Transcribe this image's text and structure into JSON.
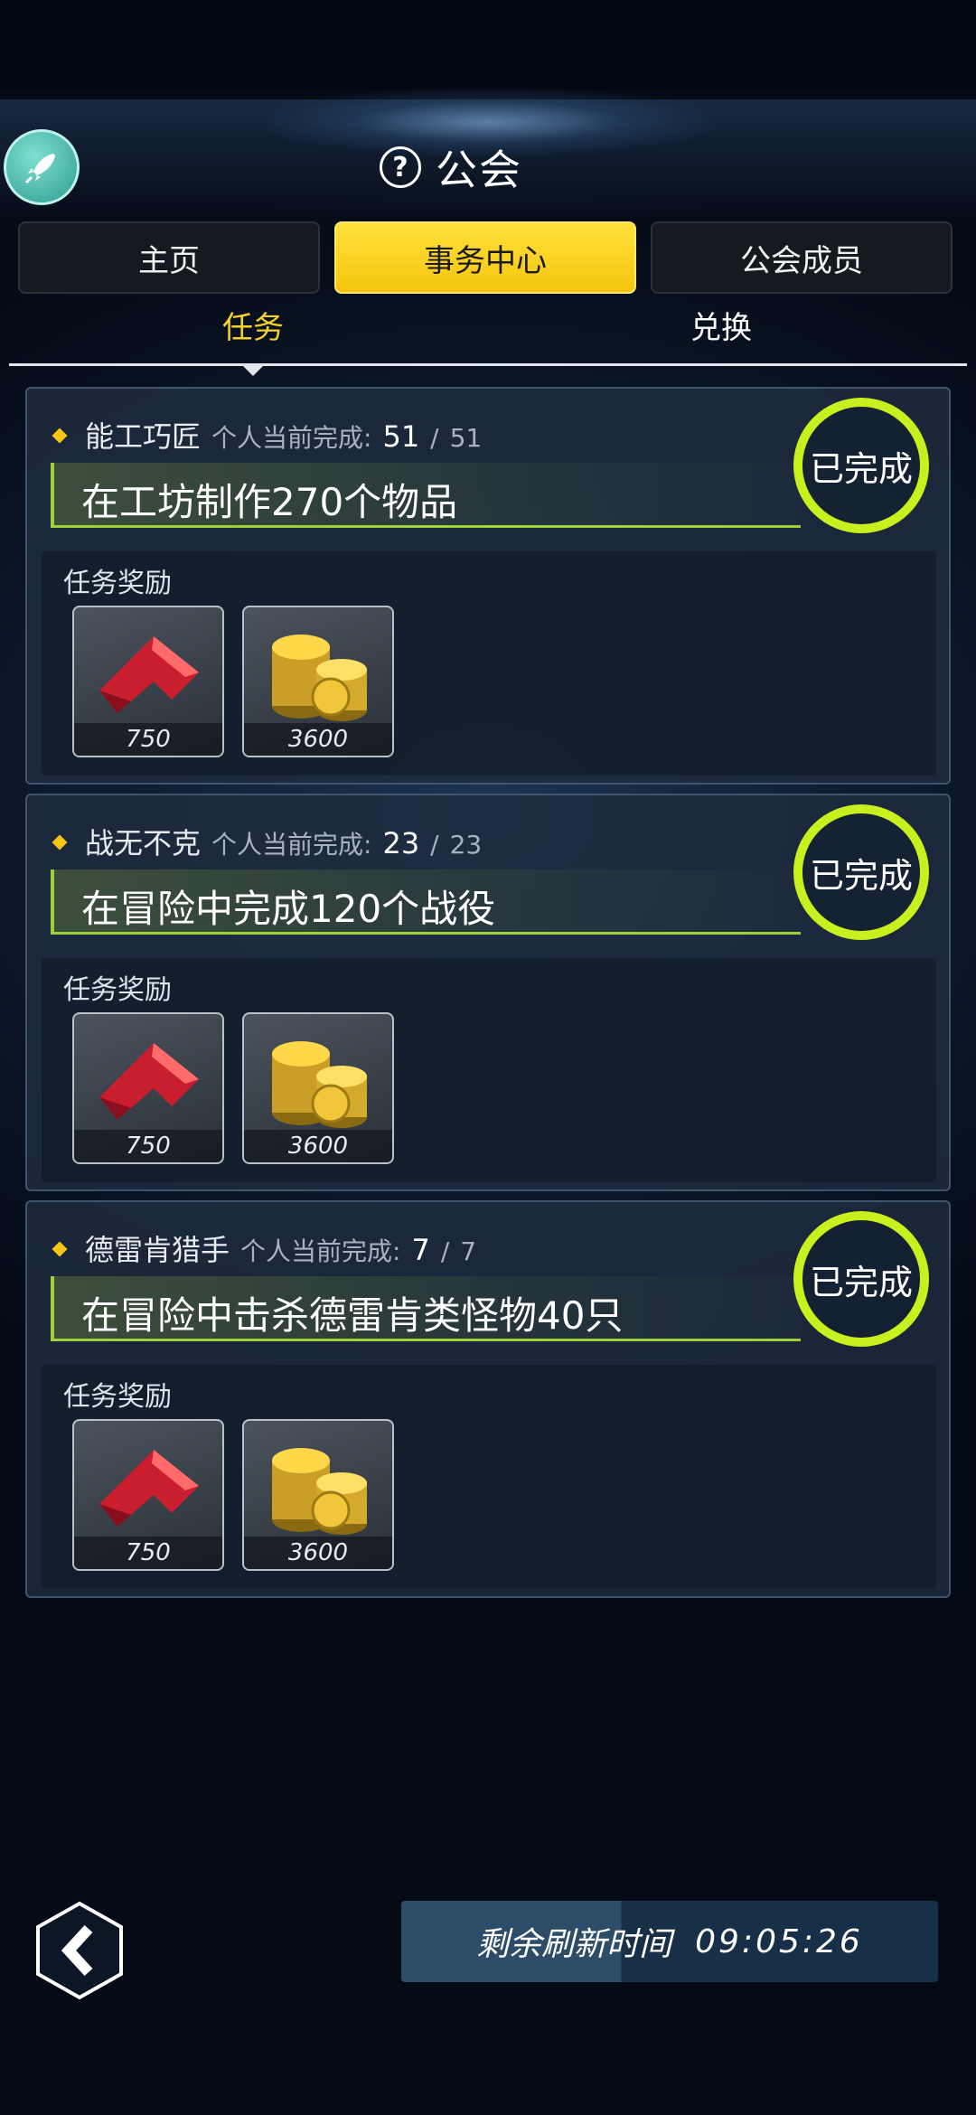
{
  "header": {
    "title": "公会"
  },
  "tabs": [
    {
      "label": "主页",
      "active": false
    },
    {
      "label": "事务中心",
      "active": true
    },
    {
      "label": "公会成员",
      "active": false
    }
  ],
  "subtabs": [
    {
      "label": "任务",
      "active": true
    },
    {
      "label": "兑换",
      "active": false
    }
  ],
  "quests": [
    {
      "name": "能工巧匠",
      "progress_label": "个人当前完成:",
      "current": "51",
      "separator": "/",
      "total": "51",
      "description": "在工坊制作270个物品",
      "status": "已完成",
      "rewards_label": "任务奖励",
      "rewards": [
        {
          "icon": "red-gem-icon",
          "count": "750"
        },
        {
          "icon": "gold-coins-icon",
          "count": "3600"
        }
      ]
    },
    {
      "name": "战无不克",
      "progress_label": "个人当前完成:",
      "current": "23",
      "separator": "/",
      "total": "23",
      "description": "在冒险中完成120个战役",
      "status": "已完成",
      "rewards_label": "任务奖励",
      "rewards": [
        {
          "icon": "red-gem-icon",
          "count": "750"
        },
        {
          "icon": "gold-coins-icon",
          "count": "3600"
        }
      ]
    },
    {
      "name": "德雷肯猎手",
      "progress_label": "个人当前完成:",
      "current": "7",
      "separator": "/",
      "total": "7",
      "description": "在冒险中击杀德雷肯类怪物40只",
      "status": "已完成",
      "rewards_label": "任务奖励",
      "rewards": [
        {
          "icon": "red-gem-icon",
          "count": "750"
        },
        {
          "icon": "gold-coins-icon",
          "count": "3600"
        }
      ]
    }
  ],
  "footer": {
    "refresh_label": "剩余刷新时间",
    "refresh_time": "09:05:26"
  },
  "colors": {
    "accent_yellow": "#f5d22b",
    "complete_green": "#c8f01e"
  }
}
